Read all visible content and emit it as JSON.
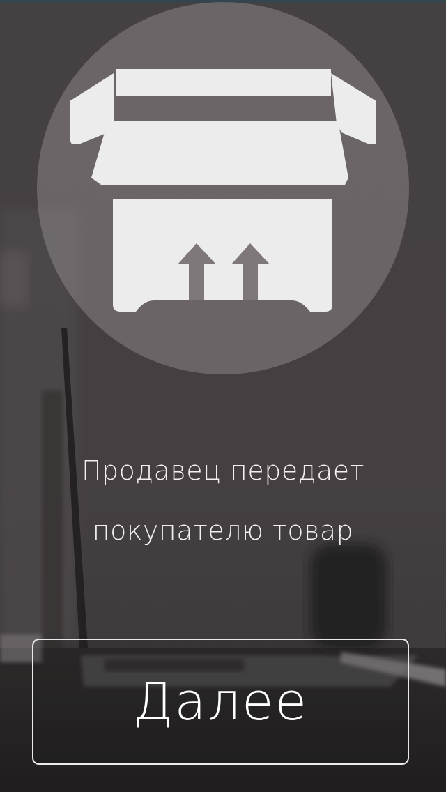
{
  "onboarding": {
    "caption_line1": "Продавец передает",
    "caption_line2": "покупателю товар",
    "next_label": "Далее",
    "icon": "open-box-with-up-arrows-icon"
  },
  "colors": {
    "overlay_tint": "#4a4446",
    "icon_circle": "#8e878a",
    "icon_fill": "#ececec",
    "text": "#f2f0f1",
    "button_border": "#ece9ea",
    "top_bar": "#35454d"
  }
}
